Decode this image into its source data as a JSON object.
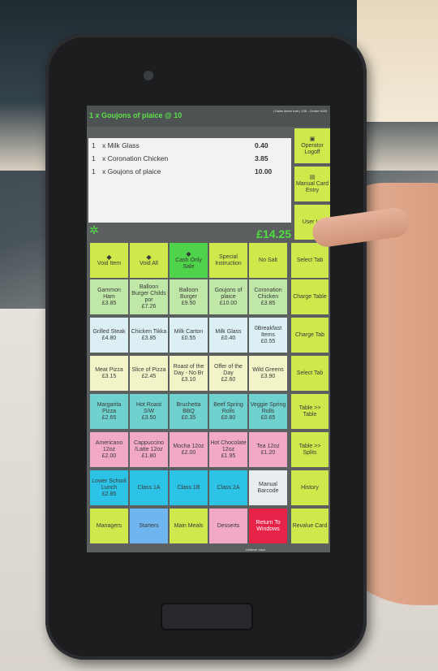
{
  "header": {
    "title": "1 x Goujons of plaice @ 10",
    "status": "| Sales demo trad | 108 - Cinder HUB"
  },
  "order": {
    "lines": [
      {
        "qty": "1",
        "name": "x Milk Glass",
        "price": "0.40"
      },
      {
        "qty": "1",
        "name": "x Coronation Chicken",
        "price": "3.85"
      },
      {
        "qty": "1",
        "name": "x Goujons of plaice",
        "price": "10.00"
      }
    ],
    "total": "£14.25"
  },
  "side_buttons": [
    {
      "label": "Operator Logoff",
      "icon": "lock-icon"
    },
    {
      "label": "Manual Card Entry",
      "icon": "card-icon"
    },
    {
      "label": "User Lo",
      "icon": ""
    }
  ],
  "function_row": [
    {
      "label": "Void Item",
      "icon": "void-icon",
      "color": "#cfe84b"
    },
    {
      "label": "Void All",
      "icon": "void-all-icon",
      "color": "#cfe84b"
    },
    {
      "label": "Cash Only Sale",
      "icon": "cash-icon",
      "color": "#4fd34a"
    },
    {
      "label": "Special Instruction",
      "icon": "",
      "color": "#cfe84b"
    },
    {
      "label": "No Salt",
      "icon": "",
      "color": "#cfe84b"
    },
    {
      "label": "Select Tab",
      "icon": "",
      "color": "#cfe84b"
    }
  ],
  "grid": [
    [
      {
        "label": "Gammon Ham\n£3.85",
        "color": "#bfe8a8"
      },
      {
        "label": "Balloon Burger Childs por\n£7.26",
        "color": "#bfe8a8"
      },
      {
        "label": "Balloon Burger\n£9.50",
        "color": "#bfe8a8"
      },
      {
        "label": "Goujons of plaice\n£10.00",
        "color": "#bfe8a8"
      },
      {
        "label": "Coronation Chicken\n£3.85",
        "color": "#bfe8a8"
      },
      {
        "label": "Charge Table",
        "color": "#cfe84b"
      }
    ],
    [
      {
        "label": "Grilled Steak\n£4.80",
        "color": "#dbeff5"
      },
      {
        "label": "Chicken Tikka\n£3.85",
        "color": "#dbeff5"
      },
      {
        "label": "Milk Carton\n£0.55",
        "color": "#dbeff5"
      },
      {
        "label": "Milk Glass\n£0.40",
        "color": "#dbeff5"
      },
      {
        "label": "0Breakfast Items\n£0.55",
        "color": "#dbeff5"
      },
      {
        "label": "Charge Tab",
        "color": "#cfe84b"
      }
    ],
    [
      {
        "label": "Meat Pizza\n£3.15",
        "color": "#f3f3c8"
      },
      {
        "label": "Slice of Pizza\n£2.45",
        "color": "#f3f3c8"
      },
      {
        "label": "Roast of the Day - No Br\n£3.10",
        "color": "#f3f3c8"
      },
      {
        "label": "Offer of the Day\n£2.60",
        "color": "#f3f3c8"
      },
      {
        "label": "Wild Greens\n£3.90",
        "color": "#f3f3c8"
      },
      {
        "label": "Select Tab",
        "color": "#cfe84b"
      }
    ],
    [
      {
        "label": "Margarita Pizza\n£2.65",
        "color": "#6fd2cf"
      },
      {
        "label": "Hot Roast S/W\n£3.50",
        "color": "#6fd2cf"
      },
      {
        "label": "Bruchetta BBQ\n£0.35",
        "color": "#6fd2cf"
      },
      {
        "label": "Beef Spring Rolls\n£0.80",
        "color": "#6fd2cf"
      },
      {
        "label": "Veggie Spring Rolls\n£0.65",
        "color": "#6fd2cf"
      },
      {
        "label": "Table >> Table",
        "color": "#cfe84b"
      }
    ],
    [
      {
        "label": "Americano 12oz\n£2.00",
        "color": "#f2a9c8"
      },
      {
        "label": "Cappuccino /Latte 12oz\n£1.80",
        "color": "#f2a9c8"
      },
      {
        "label": "Mocha 12oz\n£2.00",
        "color": "#f2a9c8"
      },
      {
        "label": "Hot Chocolate 12oz\n£1.95",
        "color": "#f2a9c8"
      },
      {
        "label": "Tea 12oz\n£1.20",
        "color": "#f2a9c8"
      },
      {
        "label": "Table >> Splits",
        "color": "#cfe84b"
      }
    ],
    [
      {
        "label": "Lower School Lunch\n£2.85",
        "color": "#2cc3e6"
      },
      {
        "label": "Class 1A",
        "color": "#2cc3e6"
      },
      {
        "label": "Class 1B",
        "color": "#2cc3e6"
      },
      {
        "label": "Class 2A",
        "color": "#2cc3e6"
      },
      {
        "label": "Manual Barcode",
        "color": "#e8eef0"
      },
      {
        "label": "History",
        "color": "#cfe84b"
      }
    ],
    [
      {
        "label": "Managers",
        "color": "#cfe84b"
      },
      {
        "label": "Starters",
        "color": "#6fb6f0"
      },
      {
        "label": "Main Meals",
        "color": "#cfe84b"
      },
      {
        "label": "Desserts",
        "color": "#f2a9c8"
      },
      {
        "label": "Return To Windows",
        "color": "#e8234a"
      },
      {
        "label": "Revalue Card",
        "color": "#cfe84b"
      }
    ]
  ],
  "footer": "Unilever User"
}
